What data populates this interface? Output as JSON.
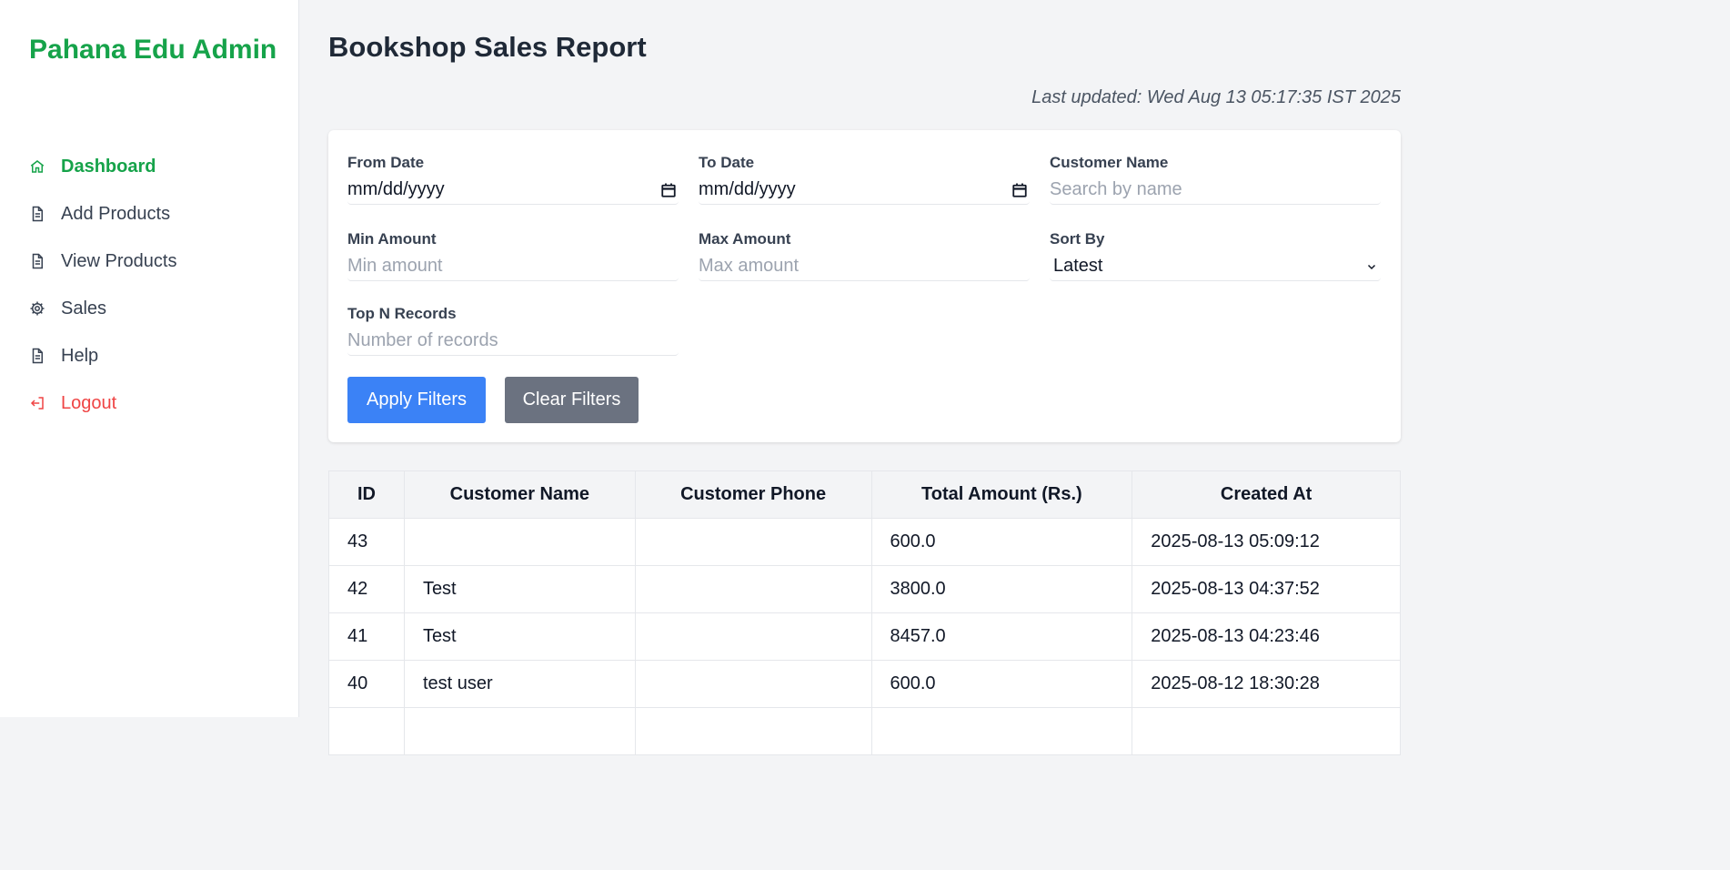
{
  "sidebar": {
    "brand": "Pahana Edu Admin",
    "items": [
      {
        "label": "Dashboard",
        "icon": "home-icon"
      },
      {
        "label": "Add Products",
        "icon": "document-icon"
      },
      {
        "label": "View Products",
        "icon": "document-icon"
      },
      {
        "label": "Sales",
        "icon": "gear-icon"
      },
      {
        "label": "Help",
        "icon": "document-icon"
      },
      {
        "label": "Logout",
        "icon": "logout-icon"
      }
    ]
  },
  "header": {
    "title": "Bookshop Sales Report",
    "last_updated": "Last updated: Wed Aug 13 05:17:35 IST 2025"
  },
  "filters": {
    "from_date": {
      "label": "From Date",
      "value": "mm/dd/yyyy"
    },
    "to_date": {
      "label": "To Date",
      "value": "mm/dd/yyyy"
    },
    "customer_name": {
      "label": "Customer Name",
      "placeholder": "Search by name"
    },
    "min_amount": {
      "label": "Min Amount",
      "placeholder": "Min amount"
    },
    "max_amount": {
      "label": "Max Amount",
      "placeholder": "Max amount"
    },
    "sort_by": {
      "label": "Sort By",
      "value": "Latest"
    },
    "top_n": {
      "label": "Top N Records",
      "placeholder": "Number of records"
    },
    "apply_label": "Apply Filters",
    "clear_label": "Clear Filters"
  },
  "table": {
    "headers": [
      "ID",
      "Customer Name",
      "Customer Phone",
      "Total Amount (Rs.)",
      "Created At"
    ],
    "rows": [
      [
        "43",
        "",
        "",
        "600.0",
        "2025-08-13 05:09:12"
      ],
      [
        "42",
        "Test",
        "",
        "3800.0",
        "2025-08-13 04:37:52"
      ],
      [
        "41",
        "Test",
        "",
        "8457.0",
        "2025-08-13 04:23:46"
      ],
      [
        "40",
        "test user",
        "",
        "600.0",
        "2025-08-12 18:30:28"
      ]
    ]
  },
  "colors": {
    "brand": "#16a34a",
    "logout": "#ef4444",
    "apply": "#3b82f6",
    "clear": "#6b7280"
  }
}
